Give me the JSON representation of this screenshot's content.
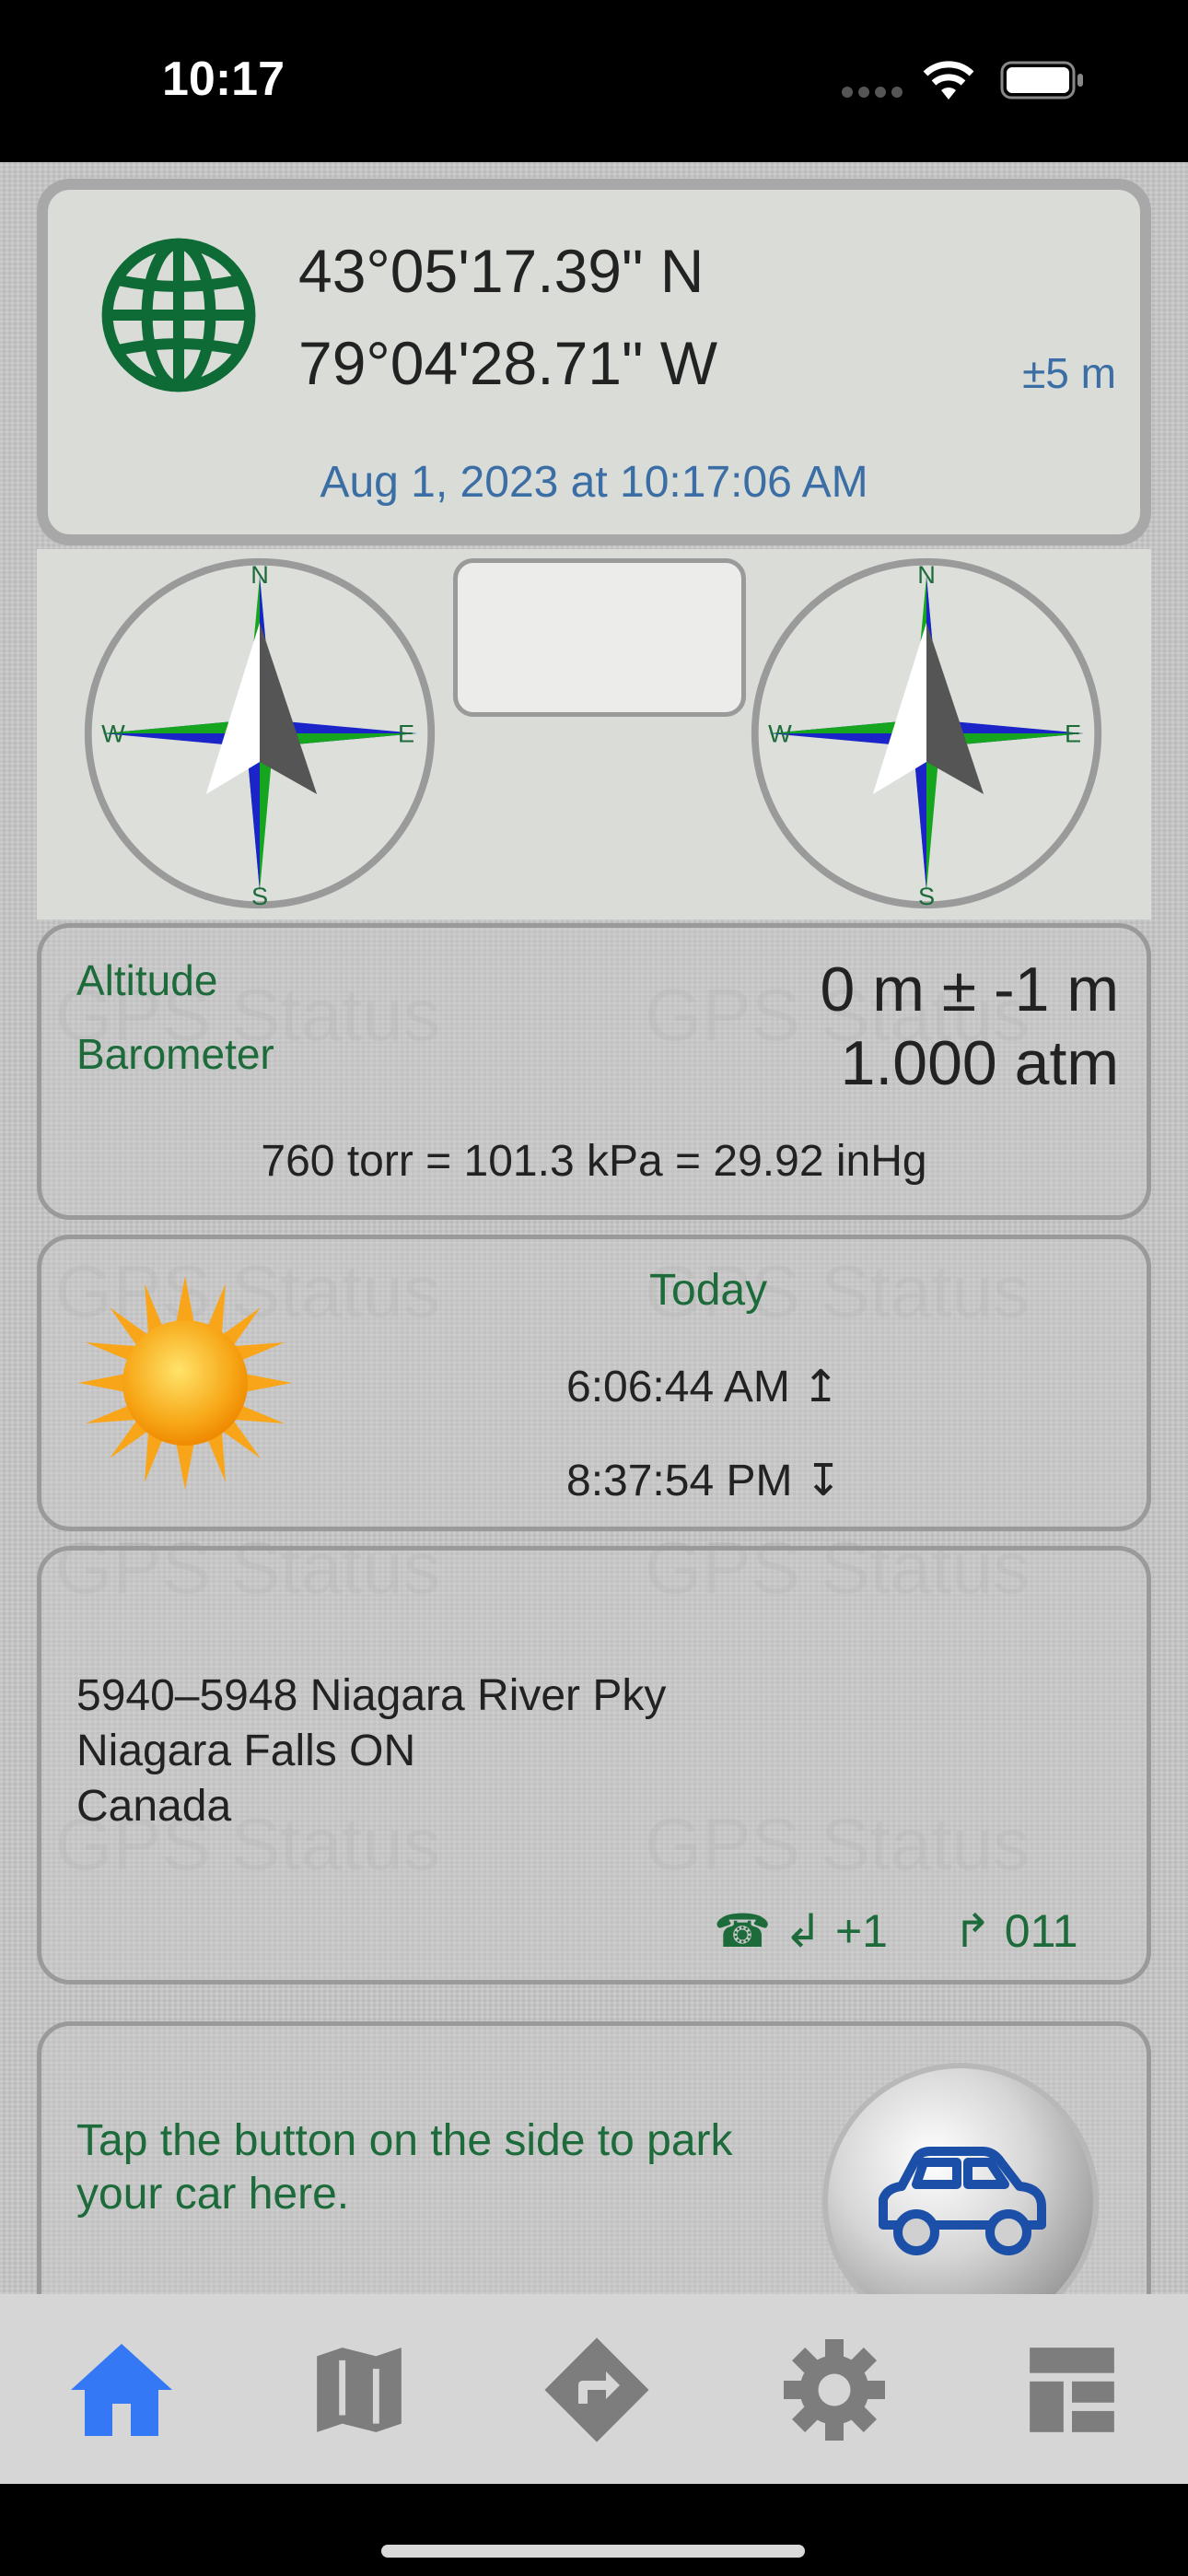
{
  "status_bar": {
    "time": "10:17"
  },
  "location": {
    "latitude": "43°05'17.39\" N",
    "longitude": "79°04'28.71\" W",
    "accuracy": "±5 m",
    "timestamp": "Aug 1, 2023 at 10:17:06 AM"
  },
  "compass": {
    "north": "N",
    "south": "S",
    "east": "E",
    "west": "W"
  },
  "altitude": {
    "label": "Altitude",
    "value": "0 m ± -1 m",
    "barometer_label": "Barometer",
    "barometer_value": "1.000 atm",
    "conversions": "760 torr = 101.3 kPa = 29.92 inHg"
  },
  "sun": {
    "day_label": "Today",
    "sunrise": "6:06:44 AM ↥",
    "sunset": "8:37:54 PM ↧"
  },
  "address": {
    "line1": "5940–5948 Niagara River Pky",
    "line2": "Niagara Falls ON",
    "line3": "Canada",
    "dial_in": "☎ ↲ +1",
    "dial_out": "↱ 011"
  },
  "parking": {
    "message": "Tap the button on the side to park your car here."
  },
  "watermark": "GPS Status",
  "colors": {
    "accent_blue": "#3478f6",
    "green": "#1d6b3a",
    "link_blue": "#3a6ea5"
  },
  "tabs": [
    {
      "icon": "home-icon",
      "active": true
    },
    {
      "icon": "map-icon",
      "active": false
    },
    {
      "icon": "directions-icon",
      "active": false
    },
    {
      "icon": "gear-icon",
      "active": false
    },
    {
      "icon": "dashboard-icon",
      "active": false
    }
  ]
}
